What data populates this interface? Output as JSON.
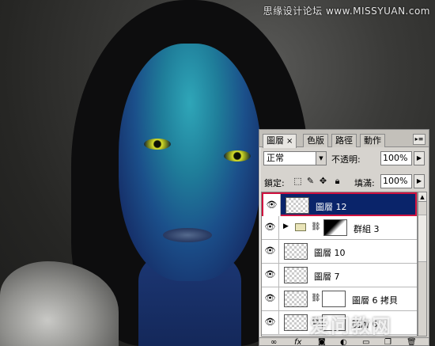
{
  "watermark": {
    "top": "思缘设计论坛 www.MISSYUAN.com",
    "bottom": "爱问教网"
  },
  "panel": {
    "tabs": [
      {
        "label": "圖層",
        "close": "×",
        "active": true
      },
      {
        "label": "色版",
        "active": false
      },
      {
        "label": "路徑",
        "active": false
      },
      {
        "label": "動作",
        "active": false
      }
    ],
    "menu_icon": "panel-menu-icon",
    "blend_mode": "正常",
    "opacity_label": "不透明:",
    "opacity_value": "100%",
    "lock_label": "鎖定:",
    "fill_label": "填滿:",
    "fill_value": "100%",
    "layers": [
      {
        "name": "圖層 12",
        "selected": true
      },
      {
        "name": "群組 3",
        "type": "group"
      },
      {
        "name": "圖層 10"
      },
      {
        "name": "圖層 7"
      },
      {
        "name": "圖層 6 拷貝"
      },
      {
        "name": "圖層 6"
      }
    ],
    "bottom_icons": [
      "link-icon",
      "fx-icon",
      "mask-icon",
      "adjustment-icon",
      "folder-icon",
      "new-layer-icon",
      "trash-icon"
    ]
  }
}
